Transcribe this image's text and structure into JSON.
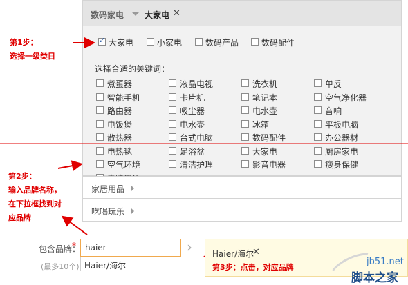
{
  "panel": {
    "header": {
      "category": "数码家电",
      "selected": "大家电",
      "close_glyph": "✕"
    },
    "level1": [
      {
        "label": "大家电",
        "checked": true
      },
      {
        "label": "小家电",
        "checked": false
      },
      {
        "label": "数码产品",
        "checked": false
      },
      {
        "label": "数码配件",
        "checked": false
      }
    ],
    "keywords_title": "选择合适的关键词：",
    "keywords": [
      [
        "煮蛋器",
        "液晶电视",
        "洗衣机",
        "单反"
      ],
      [
        "智能手机",
        "卡片机",
        "笔记本",
        "空气净化器"
      ],
      [
        "路由器",
        "吸尘器",
        "电水壶",
        "音响"
      ],
      [
        "电饭煲",
        "电水壶",
        "冰箱",
        "平板电脑"
      ],
      [
        "散热器",
        "台式电脑",
        "数码配件",
        "办公器材"
      ],
      [
        "电热毯",
        "足浴盆",
        "大家电",
        "厨房家电"
      ],
      [
        "空气环境",
        "清洁护理",
        "影音电器",
        "瘦身保健"
      ],
      [
        "电脑周边"
      ]
    ]
  },
  "accordion": [
    {
      "label": "家居用品"
    },
    {
      "label": "吃喝玩乐"
    }
  ],
  "brand": {
    "label": "包含品牌：",
    "required_mark": "*",
    "hint": "(最多10个)",
    "input_value": "haier",
    "suggestion": "Haier/海尔",
    "chevron": "›",
    "selected_tag": "Haier/海尔",
    "selected_close": "✕"
  },
  "annotations": {
    "step1_line1": "第1步：",
    "step1_line2": "选择一级类目",
    "step2_line1": "第2步：",
    "step2_line2": "输入品牌名称，",
    "step2_line3": "在下拉框找到对",
    "step2_line4": "应品牌",
    "step3": "第3步：点击，对应品牌",
    "color": "#e00000"
  },
  "watermark": {
    "site": "jb51.net",
    "name": "脚本之家"
  }
}
